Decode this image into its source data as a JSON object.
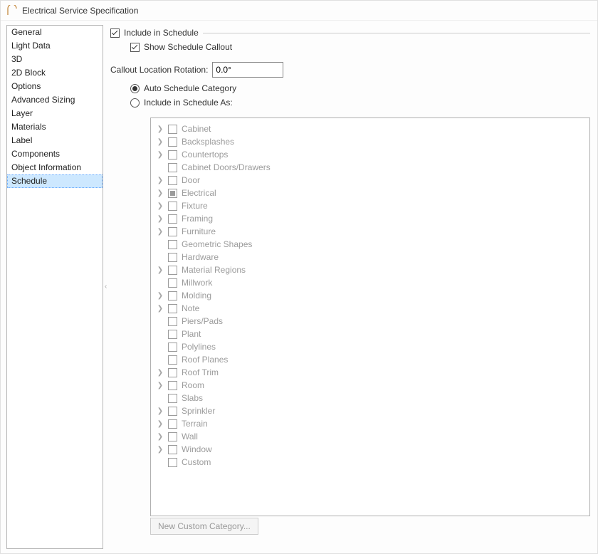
{
  "window": {
    "title": "Electrical Service Specification"
  },
  "sidebar": {
    "items": [
      "General",
      "Light Data",
      "3D",
      "2D Block",
      "Options",
      "Advanced Sizing",
      "Layer",
      "Materials",
      "Label",
      "Components",
      "Object Information",
      "Schedule"
    ],
    "selected_index": 11
  },
  "main": {
    "include_in_schedule": {
      "label": "Include in Schedule",
      "checked": true
    },
    "show_schedule_callout": {
      "label": "Show Schedule Callout",
      "checked": true
    },
    "callout_rotation": {
      "label": "Callout Location Rotation:",
      "value": "0.0°"
    },
    "auto_schedule_category": {
      "label": "Auto Schedule Category",
      "selected": true
    },
    "include_as": {
      "label": "Include in Schedule As:",
      "selected": false
    },
    "categories": [
      {
        "label": "Cabinet",
        "expandable": true,
        "state": "unchecked",
        "indent": 0
      },
      {
        "label": "Backsplashes",
        "expandable": true,
        "state": "unchecked",
        "indent": 0
      },
      {
        "label": "Countertops",
        "expandable": true,
        "state": "unchecked",
        "indent": 0
      },
      {
        "label": "Cabinet Doors/Drawers",
        "expandable": false,
        "state": "unchecked",
        "indent": 1
      },
      {
        "label": "Door",
        "expandable": true,
        "state": "unchecked",
        "indent": 0
      },
      {
        "label": "Electrical",
        "expandable": true,
        "state": "indeterminate",
        "indent": 0
      },
      {
        "label": "Fixture",
        "expandable": true,
        "state": "unchecked",
        "indent": 0
      },
      {
        "label": "Framing",
        "expandable": true,
        "state": "unchecked",
        "indent": 0
      },
      {
        "label": "Furniture",
        "expandable": true,
        "state": "unchecked",
        "indent": 0
      },
      {
        "label": "Geometric Shapes",
        "expandable": false,
        "state": "unchecked",
        "indent": 1
      },
      {
        "label": "Hardware",
        "expandable": false,
        "state": "unchecked",
        "indent": 1
      },
      {
        "label": "Material Regions",
        "expandable": true,
        "state": "unchecked",
        "indent": 0
      },
      {
        "label": "Millwork",
        "expandable": false,
        "state": "unchecked",
        "indent": 1
      },
      {
        "label": "Molding",
        "expandable": true,
        "state": "unchecked",
        "indent": 0
      },
      {
        "label": "Note",
        "expandable": true,
        "state": "unchecked",
        "indent": 0
      },
      {
        "label": "Piers/Pads",
        "expandable": false,
        "state": "unchecked",
        "indent": 1
      },
      {
        "label": "Plant",
        "expandable": false,
        "state": "unchecked",
        "indent": 1
      },
      {
        "label": "Polylines",
        "expandable": false,
        "state": "unchecked",
        "indent": 1
      },
      {
        "label": "Roof Planes",
        "expandable": false,
        "state": "unchecked",
        "indent": 1
      },
      {
        "label": "Roof Trim",
        "expandable": true,
        "state": "unchecked",
        "indent": 0
      },
      {
        "label": "Room",
        "expandable": true,
        "state": "unchecked",
        "indent": 0
      },
      {
        "label": "Slabs",
        "expandable": false,
        "state": "unchecked",
        "indent": 1
      },
      {
        "label": "Sprinkler",
        "expandable": true,
        "state": "unchecked",
        "indent": 0
      },
      {
        "label": "Terrain",
        "expandable": true,
        "state": "unchecked",
        "indent": 0
      },
      {
        "label": "Wall",
        "expandable": true,
        "state": "unchecked",
        "indent": 0
      },
      {
        "label": "Window",
        "expandable": true,
        "state": "unchecked",
        "indent": 0
      },
      {
        "label": "Custom",
        "expandable": false,
        "state": "unchecked",
        "indent": 1
      }
    ],
    "categories_enabled": false,
    "new_custom_category": {
      "label": "New Custom Category...",
      "enabled": false
    }
  }
}
